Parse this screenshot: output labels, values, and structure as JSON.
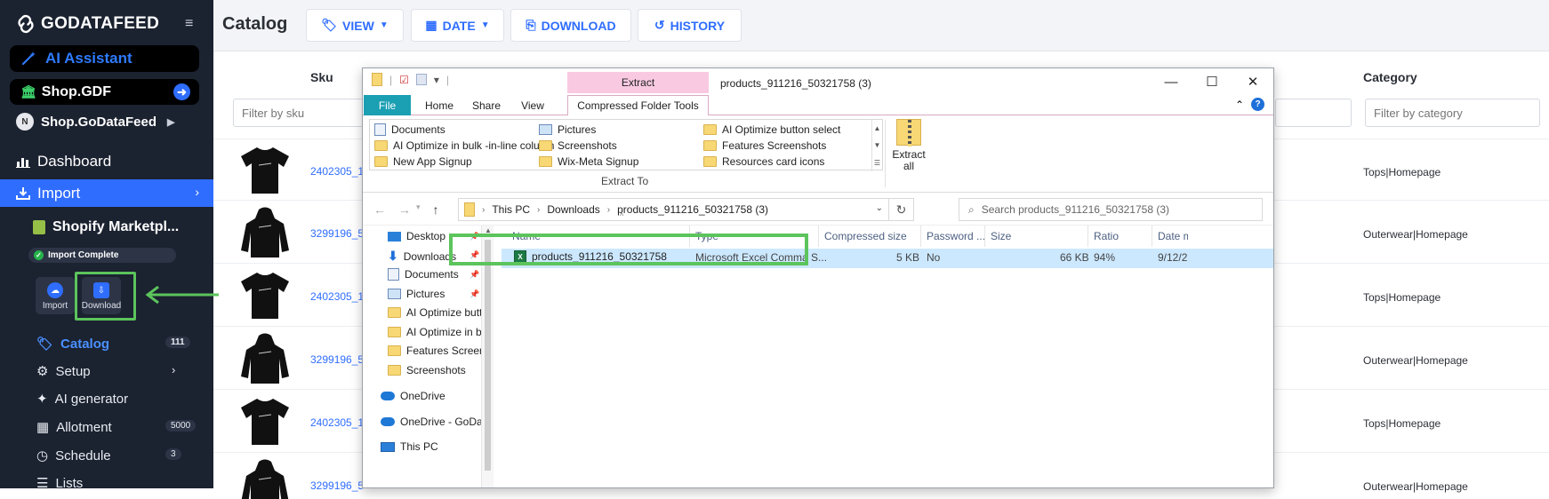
{
  "brand": {
    "name": "GODATAFEED"
  },
  "sidebar": {
    "ai_assistant": "AI Assistant",
    "shop_gdf": "Shop.GDF",
    "account_initial": "N",
    "account_name": "Shop.GoDataFeed",
    "dashboard": "Dashboard",
    "import": "Import",
    "feed_name": "Shopify Marketpl...",
    "import_status": "Import Complete",
    "import_btn": "Import",
    "download_btn": "Download",
    "items": [
      {
        "label": "Catalog",
        "badge": "111",
        "icon": "tag-icon"
      },
      {
        "label": "Setup",
        "icon": "gear-icon"
      },
      {
        "label": "AI generator",
        "icon": "wand-icon"
      },
      {
        "label": "Allotment",
        "badge": "5000",
        "icon": "calculator-icon"
      },
      {
        "label": "Schedule",
        "badge": "3",
        "icon": "clock-icon"
      },
      {
        "label": "Lists",
        "icon": "list-icon"
      }
    ]
  },
  "toolbar": {
    "title": "Catalog",
    "view": "VIEW",
    "date": "DATE",
    "download": "DOWNLOAD",
    "history": "HISTORY"
  },
  "table": {
    "col_sku": "Sku",
    "col_category": "Category",
    "filter_sku": "Filter by sku",
    "filter_category": "Filter by category",
    "rows": [
      {
        "sku": "2402305_1",
        "category": "Tops|Homepage",
        "kind": "tshirt"
      },
      {
        "sku": "3299196_5",
        "category": "Outerwear|Homepage",
        "kind": "hoodie"
      },
      {
        "sku": "2402305_1",
        "category": "Tops|Homepage",
        "kind": "tshirt"
      },
      {
        "sku": "3299196_5",
        "category": "Outerwear|Homepage",
        "kind": "hoodie"
      },
      {
        "sku": "2402305_1",
        "category": "Tops|Homepage",
        "kind": "tshirt"
      },
      {
        "sku": "3299196_5",
        "category": "Outerwear|Homepage",
        "kind": "hoodie"
      }
    ]
  },
  "explorer": {
    "extract_tab": "Extract",
    "title": "products_911216_50321758 (3)",
    "tabs": [
      "File",
      "Home",
      "Share",
      "View",
      "Compressed Folder Tools"
    ],
    "gallery": [
      {
        "label": "Documents",
        "icon": "documents-icon"
      },
      {
        "label": "AI Optimize in bulk -in-line column",
        "icon": "folder-icon"
      },
      {
        "label": "New App Signup",
        "icon": "folder-icon"
      },
      {
        "label": "Pictures",
        "icon": "pictures-icon"
      },
      {
        "label": "Screenshots",
        "icon": "folder-icon"
      },
      {
        "label": "Wix-Meta Signup",
        "icon": "folder-icon"
      },
      {
        "label": "AI Optimize button select",
        "icon": "folder-icon"
      },
      {
        "label": "Features Screenshots",
        "icon": "folder-icon"
      },
      {
        "label": "Resources card icons",
        "icon": "folder-icon"
      }
    ],
    "extract_to": "Extract To",
    "extract_all": "Extract all",
    "path": [
      "This PC",
      "Downloads",
      "products_911216_50321758 (3)"
    ],
    "search_placeholder": "Search products_911216_50321758 (3)",
    "nav": [
      {
        "label": "Desktop",
        "icon": "desktop-icon",
        "pinned": true
      },
      {
        "label": "Downloads",
        "icon": "download-icon",
        "pinned": true
      },
      {
        "label": "Documents",
        "icon": "documents-icon",
        "pinned": true
      },
      {
        "label": "Pictures",
        "icon": "pictures-icon",
        "pinned": true
      },
      {
        "label": "AI Optimize butto",
        "icon": "folder-icon"
      },
      {
        "label": "AI Optimize in bul",
        "icon": "folder-icon"
      },
      {
        "label": "Features Screensh",
        "icon": "folder-icon"
      },
      {
        "label": "Screenshots",
        "icon": "folder-icon"
      },
      {
        "label": "OneDrive",
        "icon": "cloud-icon"
      },
      {
        "label": "OneDrive - GoDataF",
        "icon": "cloud-icon"
      },
      {
        "label": "This PC",
        "icon": "pc-icon"
      }
    ],
    "columns": [
      "Name",
      "Type",
      "Compressed size",
      "Password ...",
      "Size",
      "Ratio",
      "Date m"
    ],
    "file": {
      "name": "products_911216_50321758",
      "type": "Microsoft Excel Comma S...",
      "compressed_size": "5 KB",
      "password": "No",
      "size": "66 KB",
      "ratio": "94%",
      "date": "9/12/2"
    }
  },
  "colors": {
    "accent": "#2f6dff",
    "sidebar": "#1b2230",
    "highlight": "#5cc45c"
  }
}
